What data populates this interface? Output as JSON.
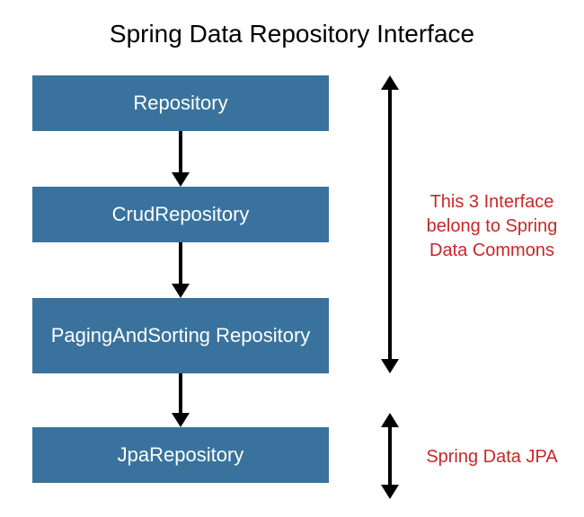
{
  "title": "Spring Data Repository Interface",
  "boxes": {
    "b1": "Repository",
    "b2": "CrudRepository",
    "b3": "PagingAndSorting Repository",
    "b4": "JpaRepository"
  },
  "annotations": {
    "commons": "This 3 Interface belong to Spring Data Commons",
    "jpa": "Spring Data JPA"
  },
  "colors": {
    "box_bg": "#39739d",
    "box_fg": "#ffffff",
    "note_fg": "#c62828"
  }
}
